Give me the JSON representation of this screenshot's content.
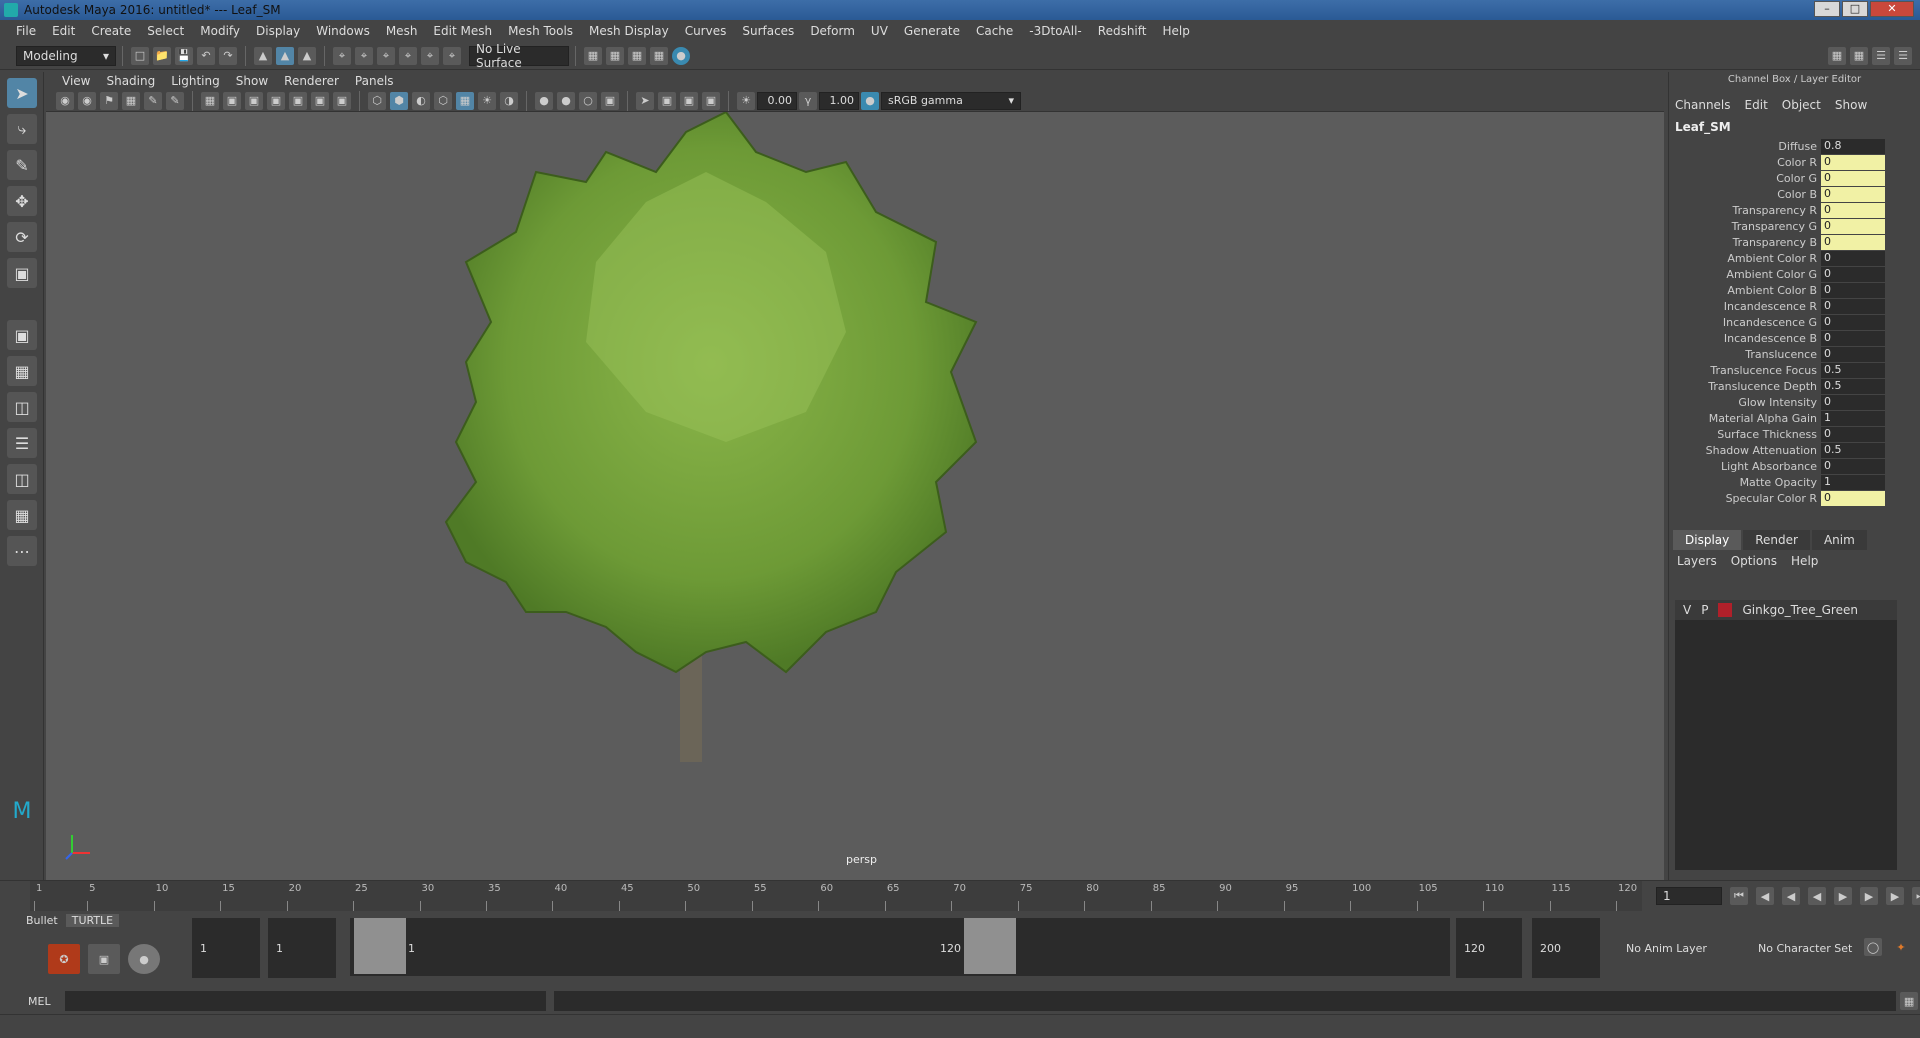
{
  "window": {
    "title": "Autodesk Maya 2016: untitled*   ---   Leaf_SM"
  },
  "menubar": [
    "File",
    "Edit",
    "Create",
    "Select",
    "Modify",
    "Display",
    "Windows",
    "Mesh",
    "Edit Mesh",
    "Mesh Tools",
    "Mesh Display",
    "Curves",
    "Surfaces",
    "Deform",
    "UV",
    "Generate",
    "Cache",
    "-3DtoAll-",
    "Redshift",
    "Help"
  ],
  "shelf": {
    "mode": "Modeling",
    "live_surface": "No Live Surface"
  },
  "viewport": {
    "menu": [
      "View",
      "Shading",
      "Lighting",
      "Show",
      "Renderer",
      "Panels"
    ],
    "exposure": "0.00",
    "gamma": "1.00",
    "color_space": "sRGB gamma",
    "camera": "persp"
  },
  "channel_box": {
    "header": "Channel Box / Layer Editor",
    "tabs": [
      "Channels",
      "Edit",
      "Object",
      "Show"
    ],
    "object": "Leaf_SM",
    "attributes": [
      {
        "label": "Diffuse",
        "value": "0.8",
        "keyed": false
      },
      {
        "label": "Color R",
        "value": "0",
        "keyed": true
      },
      {
        "label": "Color G",
        "value": "0",
        "keyed": true
      },
      {
        "label": "Color B",
        "value": "0",
        "keyed": true
      },
      {
        "label": "Transparency R",
        "value": "0",
        "keyed": true
      },
      {
        "label": "Transparency G",
        "value": "0",
        "keyed": true
      },
      {
        "label": "Transparency B",
        "value": "0",
        "keyed": true
      },
      {
        "label": "Ambient Color R",
        "value": "0",
        "keyed": false
      },
      {
        "label": "Ambient Color G",
        "value": "0",
        "keyed": false
      },
      {
        "label": "Ambient Color B",
        "value": "0",
        "keyed": false
      },
      {
        "label": "Incandescence R",
        "value": "0",
        "keyed": false
      },
      {
        "label": "Incandescence G",
        "value": "0",
        "keyed": false
      },
      {
        "label": "Incandescence B",
        "value": "0",
        "keyed": false
      },
      {
        "label": "Translucence",
        "value": "0",
        "keyed": false
      },
      {
        "label": "Translucence Focus",
        "value": "0.5",
        "keyed": false
      },
      {
        "label": "Translucence Depth",
        "value": "0.5",
        "keyed": false
      },
      {
        "label": "Glow Intensity",
        "value": "0",
        "keyed": false
      },
      {
        "label": "Material Alpha Gain",
        "value": "1",
        "keyed": false
      },
      {
        "label": "Surface Thickness",
        "value": "0",
        "keyed": false
      },
      {
        "label": "Shadow Attenuation",
        "value": "0.5",
        "keyed": false
      },
      {
        "label": "Light Absorbance",
        "value": "0",
        "keyed": false
      },
      {
        "label": "Matte Opacity",
        "value": "1",
        "keyed": false
      },
      {
        "label": "Specular Color R",
        "value": "0",
        "keyed": true
      }
    ]
  },
  "layer_editor": {
    "tabs": [
      "Display",
      "Render",
      "Anim"
    ],
    "menu": [
      "Layers",
      "Options",
      "Help"
    ],
    "layer": {
      "v": "V",
      "p": "P",
      "name": "Ginkgo_Tree_Green",
      "color": "#b0202a"
    }
  },
  "timeline": {
    "ticks": [
      "1",
      "5",
      "10",
      "15",
      "20",
      "25",
      "30",
      "35",
      "40",
      "45",
      "50",
      "55",
      "60",
      "65",
      "70",
      "75",
      "80",
      "85",
      "90",
      "95",
      "100",
      "105",
      "110",
      "115",
      "120"
    ],
    "current_frame": "1"
  },
  "range": {
    "shelf_tabs": [
      "Bullet",
      "TURTLE"
    ],
    "start": "1",
    "playback_start": "1",
    "slider_start": "1",
    "slider_end": "120",
    "playback_end": "120",
    "end": "200",
    "anim_layer": "No Anim Layer",
    "character_set": "No Character Set"
  },
  "command_line": {
    "label": "MEL"
  }
}
